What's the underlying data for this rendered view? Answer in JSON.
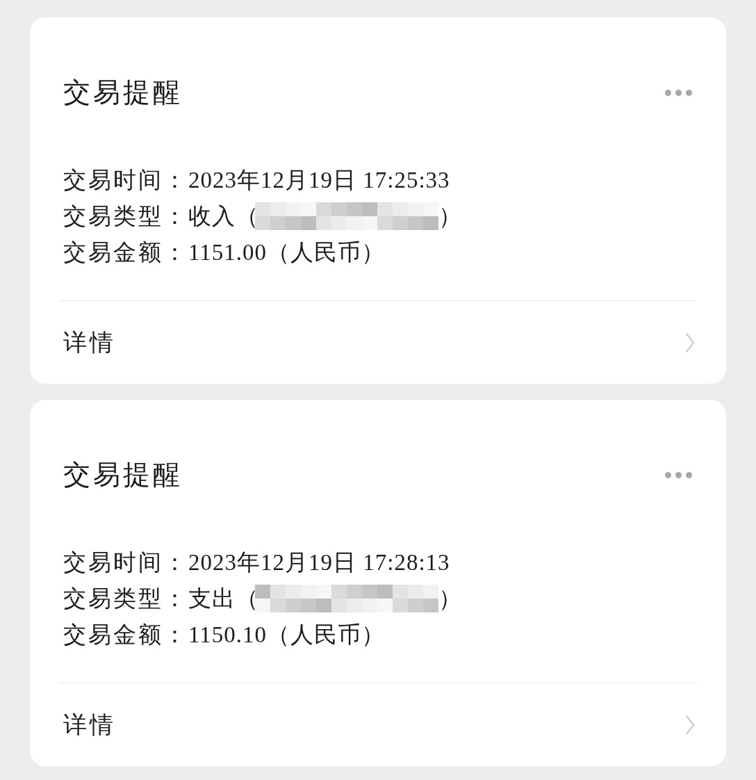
{
  "cards": [
    {
      "title": "交易提醒",
      "fields": [
        {
          "label": "交易时间：",
          "value": "2023年12月19日 17:25:33",
          "redacted": false
        },
        {
          "label": "交易类型：",
          "value": "收入（",
          "redacted": true,
          "value_end": "）"
        },
        {
          "label": "交易金额：",
          "value": "1151.00（人民币）",
          "redacted": false
        }
      ],
      "footer": "详情"
    },
    {
      "title": "交易提醒",
      "fields": [
        {
          "label": "交易时间：",
          "value": "2023年12月19日 17:28:13",
          "redacted": false
        },
        {
          "label": "交易类型：",
          "value": "支出（",
          "redacted": true,
          "value_end": "）"
        },
        {
          "label": "交易金额：",
          "value": "1150.10（人民币）",
          "redacted": false
        }
      ],
      "footer": "详情"
    }
  ]
}
